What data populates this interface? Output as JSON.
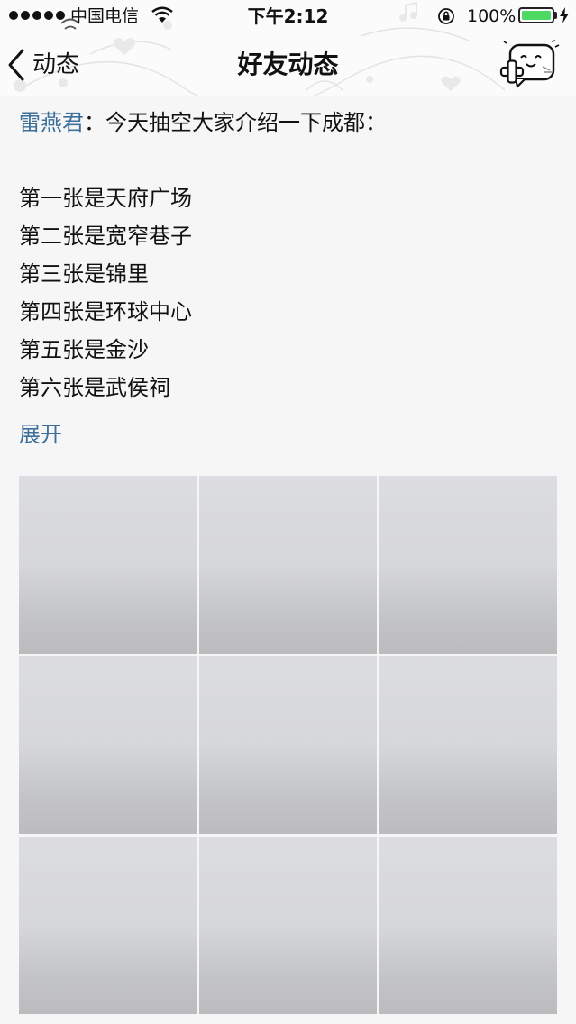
{
  "status_bar": {
    "carrier": "中国电信",
    "time": "下午2:12",
    "battery": "100%",
    "battery_level": 1.0,
    "icons": [
      "signal-dots-icon",
      "wifi-icon",
      "rotation-lock-icon",
      "battery-icon",
      "charging-icon"
    ]
  },
  "nav": {
    "back_label": "动态",
    "title": "好友动态",
    "back_icon": "chevron-left-icon",
    "action_icon": "add-friend-icon"
  },
  "post": {
    "author": "雷燕君",
    "separator": "：",
    "first_line": "今天抽空大家介绍一下成都：",
    "lines": [
      "第一张是天府广场",
      "第二张是宽窄巷子",
      "第三张是锦里",
      "第四张是环球中心",
      "第五张是金沙",
      "第六张是武侯祠"
    ],
    "expand_label": "展开"
  },
  "photos": {
    "count": 9
  },
  "colors": {
    "link": "#3d6f9b",
    "background": "#f6f6f7",
    "battery_fill": "#4cd964"
  }
}
